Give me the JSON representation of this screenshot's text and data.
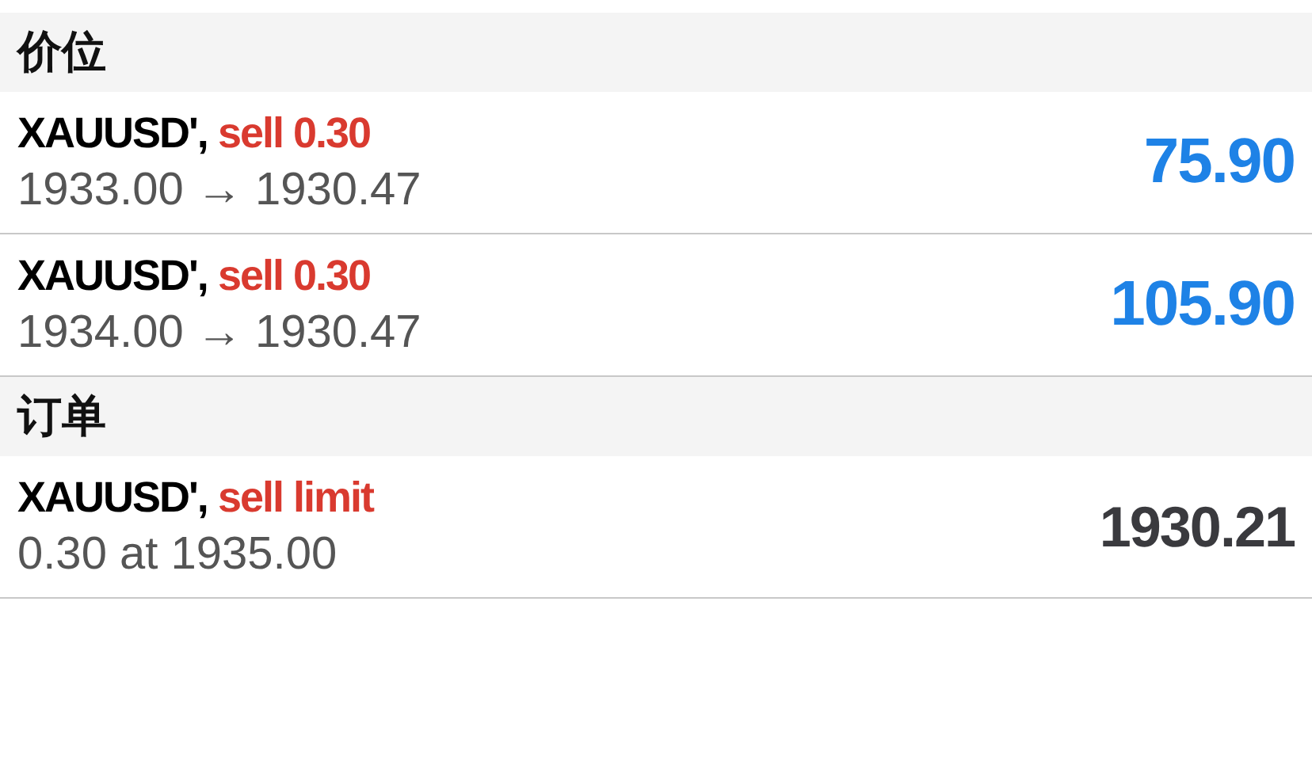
{
  "sections": [
    {
      "title": "价位",
      "items": [
        {
          "kind": "position",
          "symbol": "XAUUSD',",
          "action": "sell 0.30",
          "detail": "1933.00 → 1930.47",
          "value": "75.90"
        },
        {
          "kind": "position",
          "symbol": "XAUUSD',",
          "action": "sell 0.30",
          "detail": "1934.00 → 1930.47",
          "value": "105.90"
        }
      ]
    },
    {
      "title": "订单",
      "items": [
        {
          "kind": "order",
          "symbol": "XAUUSD',",
          "action": "sell limit",
          "detail": "0.30 at 1935.00",
          "value": "1930.21"
        }
      ]
    }
  ]
}
